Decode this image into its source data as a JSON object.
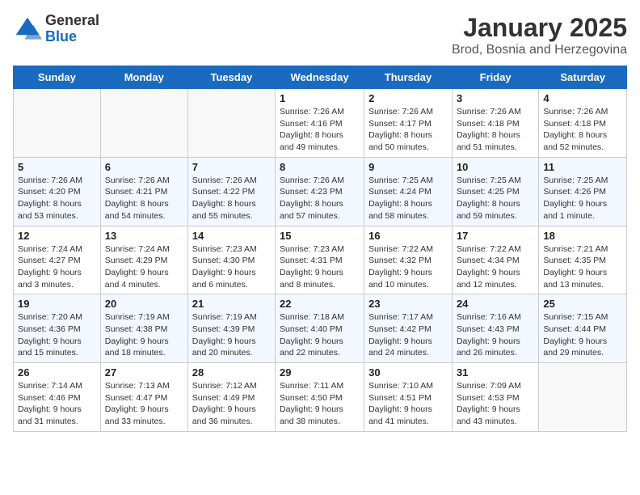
{
  "header": {
    "logo_general": "General",
    "logo_blue": "Blue",
    "month_title": "January 2025",
    "location": "Brod, Bosnia and Herzegovina"
  },
  "days_of_week": [
    "Sunday",
    "Monday",
    "Tuesday",
    "Wednesday",
    "Thursday",
    "Friday",
    "Saturday"
  ],
  "weeks": [
    [
      {
        "day": "",
        "info": ""
      },
      {
        "day": "",
        "info": ""
      },
      {
        "day": "",
        "info": ""
      },
      {
        "day": "1",
        "info": "Sunrise: 7:26 AM\nSunset: 4:16 PM\nDaylight: 8 hours and 49 minutes."
      },
      {
        "day": "2",
        "info": "Sunrise: 7:26 AM\nSunset: 4:17 PM\nDaylight: 8 hours and 50 minutes."
      },
      {
        "day": "3",
        "info": "Sunrise: 7:26 AM\nSunset: 4:18 PM\nDaylight: 8 hours and 51 minutes."
      },
      {
        "day": "4",
        "info": "Sunrise: 7:26 AM\nSunset: 4:18 PM\nDaylight: 8 hours and 52 minutes."
      }
    ],
    [
      {
        "day": "5",
        "info": "Sunrise: 7:26 AM\nSunset: 4:20 PM\nDaylight: 8 hours and 53 minutes."
      },
      {
        "day": "6",
        "info": "Sunrise: 7:26 AM\nSunset: 4:21 PM\nDaylight: 8 hours and 54 minutes."
      },
      {
        "day": "7",
        "info": "Sunrise: 7:26 AM\nSunset: 4:22 PM\nDaylight: 8 hours and 55 minutes."
      },
      {
        "day": "8",
        "info": "Sunrise: 7:26 AM\nSunset: 4:23 PM\nDaylight: 8 hours and 57 minutes."
      },
      {
        "day": "9",
        "info": "Sunrise: 7:25 AM\nSunset: 4:24 PM\nDaylight: 8 hours and 58 minutes."
      },
      {
        "day": "10",
        "info": "Sunrise: 7:25 AM\nSunset: 4:25 PM\nDaylight: 8 hours and 59 minutes."
      },
      {
        "day": "11",
        "info": "Sunrise: 7:25 AM\nSunset: 4:26 PM\nDaylight: 9 hours and 1 minute."
      }
    ],
    [
      {
        "day": "12",
        "info": "Sunrise: 7:24 AM\nSunset: 4:27 PM\nDaylight: 9 hours and 3 minutes."
      },
      {
        "day": "13",
        "info": "Sunrise: 7:24 AM\nSunset: 4:29 PM\nDaylight: 9 hours and 4 minutes."
      },
      {
        "day": "14",
        "info": "Sunrise: 7:23 AM\nSunset: 4:30 PM\nDaylight: 9 hours and 6 minutes."
      },
      {
        "day": "15",
        "info": "Sunrise: 7:23 AM\nSunset: 4:31 PM\nDaylight: 9 hours and 8 minutes."
      },
      {
        "day": "16",
        "info": "Sunrise: 7:22 AM\nSunset: 4:32 PM\nDaylight: 9 hours and 10 minutes."
      },
      {
        "day": "17",
        "info": "Sunrise: 7:22 AM\nSunset: 4:34 PM\nDaylight: 9 hours and 12 minutes."
      },
      {
        "day": "18",
        "info": "Sunrise: 7:21 AM\nSunset: 4:35 PM\nDaylight: 9 hours and 13 minutes."
      }
    ],
    [
      {
        "day": "19",
        "info": "Sunrise: 7:20 AM\nSunset: 4:36 PM\nDaylight: 9 hours and 15 minutes."
      },
      {
        "day": "20",
        "info": "Sunrise: 7:19 AM\nSunset: 4:38 PM\nDaylight: 9 hours and 18 minutes."
      },
      {
        "day": "21",
        "info": "Sunrise: 7:19 AM\nSunset: 4:39 PM\nDaylight: 9 hours and 20 minutes."
      },
      {
        "day": "22",
        "info": "Sunrise: 7:18 AM\nSunset: 4:40 PM\nDaylight: 9 hours and 22 minutes."
      },
      {
        "day": "23",
        "info": "Sunrise: 7:17 AM\nSunset: 4:42 PM\nDaylight: 9 hours and 24 minutes."
      },
      {
        "day": "24",
        "info": "Sunrise: 7:16 AM\nSunset: 4:43 PM\nDaylight: 9 hours and 26 minutes."
      },
      {
        "day": "25",
        "info": "Sunrise: 7:15 AM\nSunset: 4:44 PM\nDaylight: 9 hours and 29 minutes."
      }
    ],
    [
      {
        "day": "26",
        "info": "Sunrise: 7:14 AM\nSunset: 4:46 PM\nDaylight: 9 hours and 31 minutes."
      },
      {
        "day": "27",
        "info": "Sunrise: 7:13 AM\nSunset: 4:47 PM\nDaylight: 9 hours and 33 minutes."
      },
      {
        "day": "28",
        "info": "Sunrise: 7:12 AM\nSunset: 4:49 PM\nDaylight: 9 hours and 36 minutes."
      },
      {
        "day": "29",
        "info": "Sunrise: 7:11 AM\nSunset: 4:50 PM\nDaylight: 9 hours and 38 minutes."
      },
      {
        "day": "30",
        "info": "Sunrise: 7:10 AM\nSunset: 4:51 PM\nDaylight: 9 hours and 41 minutes."
      },
      {
        "day": "31",
        "info": "Sunrise: 7:09 AM\nSunset: 4:53 PM\nDaylight: 9 hours and 43 minutes."
      },
      {
        "day": "",
        "info": ""
      }
    ]
  ]
}
